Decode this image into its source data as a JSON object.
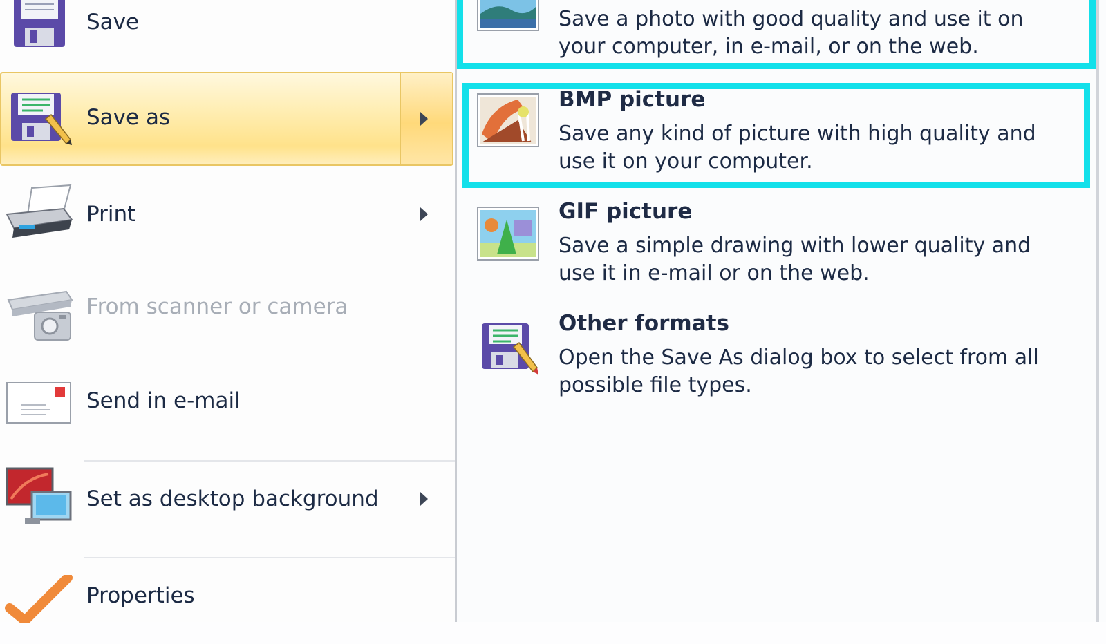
{
  "menu": {
    "items": [
      {
        "label": "Save",
        "icon": "floppy-disk-icon"
      },
      {
        "label": "Save as",
        "icon": "floppy-pencil-icon",
        "has_submenu": true,
        "highlighted": true
      },
      {
        "label": "Print",
        "icon": "printer-icon",
        "has_submenu": true
      },
      {
        "label": "From scanner or camera",
        "icon": "scanner-camera-icon",
        "disabled": true
      },
      {
        "label": "Send in e-mail",
        "icon": "envelope-icon"
      },
      {
        "label": "Set as desktop background",
        "icon": "monitor-icon",
        "has_submenu": true
      },
      {
        "label": "Properties",
        "icon": "checkmark-icon"
      }
    ]
  },
  "formats": [
    {
      "title": "",
      "description": "Save a photo with good quality and use it on your computer, in e-mail, or on the web.",
      "icon": "jpeg-photo-icon"
    },
    {
      "title": "BMP picture",
      "description": "Save any kind of picture with high quality and use it on your computer.",
      "icon": "bmp-paint-icon"
    },
    {
      "title": "GIF picture",
      "description": "Save a simple drawing with lower quality and use it in e-mail or on the web.",
      "icon": "gif-shapes-icon"
    },
    {
      "title": "Other formats",
      "description": "Open the Save As dialog box to select from all possible file types.",
      "icon": "floppy-pencil-icon"
    }
  ],
  "colors": {
    "highlight_box": "#13e0ea",
    "menu_hover": "#ffe28a",
    "text": "#1c2a44",
    "disabled_text": "#a7adb6"
  }
}
